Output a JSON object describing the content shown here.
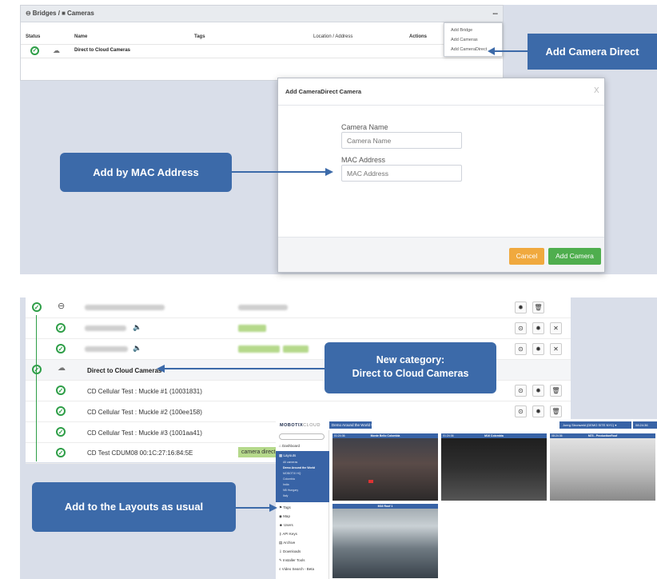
{
  "top": {
    "breadcrumb": "Bridges / ",
    "breadcrumb_cameras": "Cameras",
    "more_icon": "...",
    "table": {
      "headers": {
        "status": "Status",
        "name": "Name",
        "tags": "Tags",
        "location": "Location / Address",
        "actions": "Actions"
      },
      "row": {
        "name": "Direct to Cloud Cameras"
      }
    },
    "dropdown": [
      "Add Bridge",
      "Add Cameras",
      "Add CameraDirect"
    ],
    "callout_direct": "Add Camera Direct",
    "modal": {
      "title": "Add CameraDirect Camera",
      "close": "X",
      "camera_name_label": "Camera Name",
      "camera_name_placeholder": "Camera Name",
      "mac_label": "MAC Address",
      "mac_placeholder": "MAC Address",
      "cancel": "Cancel",
      "add": "Add Camera"
    },
    "callout_mac": "Add by MAC Address"
  },
  "bottom": {
    "category_row": "Direct to Cloud Cameras",
    "cameras": [
      "CD Cellular Test : Muckle #1 (10031831)",
      "CD Cellular Test : Muckle #2 (100ee158)",
      "CD Cellular Test : Muckle #3 (1001aa41)",
      "CD Test CDUM08 00:1C:27:16:84:5E"
    ],
    "last_tag": "camera direct",
    "callout_category_line1": "New category:",
    "callout_category_line2": "Direct to Cloud Cameras",
    "callout_layouts": "Add to the Layouts as usual"
  },
  "app": {
    "logo": "MOBOTIX",
    "logo_suffix": "CLOUD",
    "layout_select": "Demo Around the World ▾",
    "user": "Joerg Stronweld (DEMO SITE NYC) ▾",
    "time": "08:24:36",
    "nav": [
      "Dashboard",
      "Layouts",
      "Tags",
      "Map",
      "Users",
      "API Keys",
      "Archive",
      "Downloads",
      "Installer Tools",
      "Video Search - Beta"
    ],
    "layouts_sub": [
      "All cameras",
      "Demo Around the World",
      "MOBOTIX HQ",
      "Colombia",
      "India",
      "NB Hungary",
      "Italy"
    ],
    "cams": [
      {
        "time": "01:24:36",
        "name": "Monte Bello Colombia"
      },
      {
        "time": "01:24:36",
        "name": "M16 Colombia"
      },
      {
        "time": "08:24:36",
        "name": "M73 - ProductionRoof"
      },
      {
        "time": "",
        "name": "M16 Roof 1"
      }
    ]
  }
}
